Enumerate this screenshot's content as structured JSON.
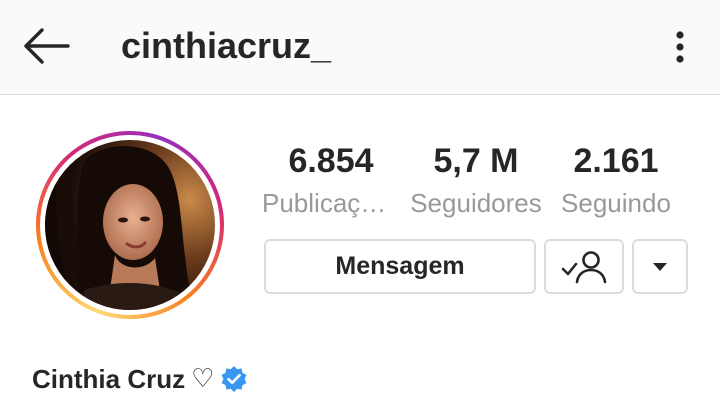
{
  "header": {
    "username": "cinthiacruz_",
    "back_icon": "arrow-left-icon",
    "more_icon": "kebab-menu-icon"
  },
  "profile": {
    "avatar_icon": "profile-photo",
    "stats": [
      {
        "value": "6.854",
        "label": "Publicações"
      },
      {
        "value": "5,7 M",
        "label": "Seguidores"
      },
      {
        "value": "2.161",
        "label": "Seguindo"
      }
    ],
    "message_button": "Mensagem",
    "following_icon": "check-person-icon",
    "dropdown_icon": "caret-down-icon",
    "full_name": "Cinthia Cruz",
    "name_emoji": "♡",
    "verified_icon": "verified-badge-icon",
    "colors": {
      "text": "#262626",
      "muted": "#999999",
      "border": "#dbdbdb",
      "verified": "#3897f0"
    }
  }
}
